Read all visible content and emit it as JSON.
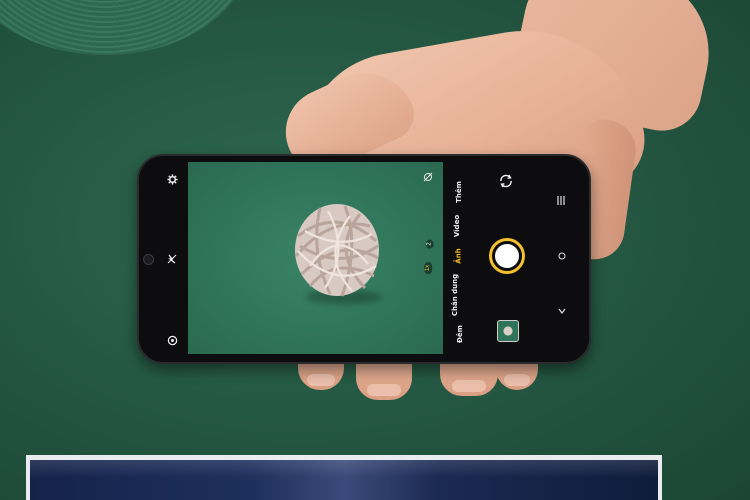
{
  "camera": {
    "modes": [
      {
        "label": "Thêm",
        "active": false
      },
      {
        "label": "Video",
        "active": false
      },
      {
        "label": "Ảnh",
        "active": true
      },
      {
        "label": "Chân dung",
        "active": false
      },
      {
        "label": "Đêm",
        "active": false
      }
    ],
    "zoom": {
      "wide": "1x",
      "tele": "2"
    },
    "accent_color": "#f5c12b",
    "icons": {
      "settings": "gear-icon",
      "flash": "flash-off-icon",
      "filter": "filter-icon",
      "switch_camera": "switch-camera-icon",
      "menu": "menu-icon",
      "more": "more-icon",
      "expand": "chevron-icon",
      "ai": "ai-scene-icon"
    }
  }
}
